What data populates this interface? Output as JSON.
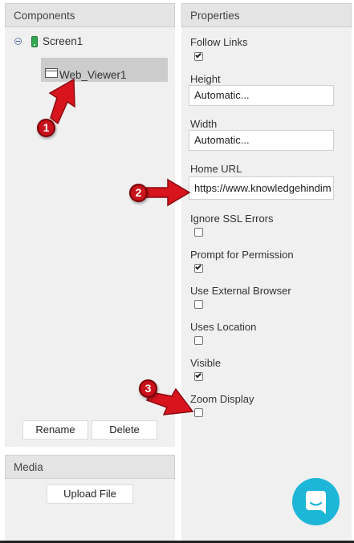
{
  "components_panel": {
    "title": "Components",
    "tree": {
      "screen": {
        "label": "Screen1"
      },
      "web_viewer": {
        "label": "Web_Viewer1"
      }
    },
    "buttons": {
      "rename": "Rename",
      "delete": "Delete"
    }
  },
  "media_panel": {
    "title": "Media",
    "upload_label": "Upload File"
  },
  "properties_panel": {
    "title": "Properties",
    "follow_links": {
      "label": "Follow Links",
      "checked": true
    },
    "height": {
      "label": "Height",
      "value": "Automatic..."
    },
    "width": {
      "label": "Width",
      "value": "Automatic..."
    },
    "home_url": {
      "label": "Home URL",
      "value": "https://www.knowledgehindim"
    },
    "ignore_ssl_errors": {
      "label": "Ignore SSL Errors",
      "checked": false
    },
    "prompt_for_permission": {
      "label": "Prompt for Permission",
      "checked": true
    },
    "use_external_browser": {
      "label": "Use External Browser",
      "checked": false
    },
    "uses_location": {
      "label": "Uses Location",
      "checked": false
    },
    "visible": {
      "label": "Visible",
      "checked": true
    },
    "zoom_display": {
      "label": "Zoom Display",
      "checked": false
    }
  },
  "annotations": {
    "marker_1": "1",
    "marker_2": "2",
    "marker_3": "3",
    "color": "#c8111a"
  },
  "icons": {
    "screen": "phone-icon",
    "web_viewer": "window-icon",
    "chat": "chat-icon"
  },
  "colors": {
    "panel_bg": "#f0f0f0",
    "header_bg": "#e4e4e4",
    "selected_row": "#cccccc",
    "chat_accent": "#1eb6d8"
  }
}
